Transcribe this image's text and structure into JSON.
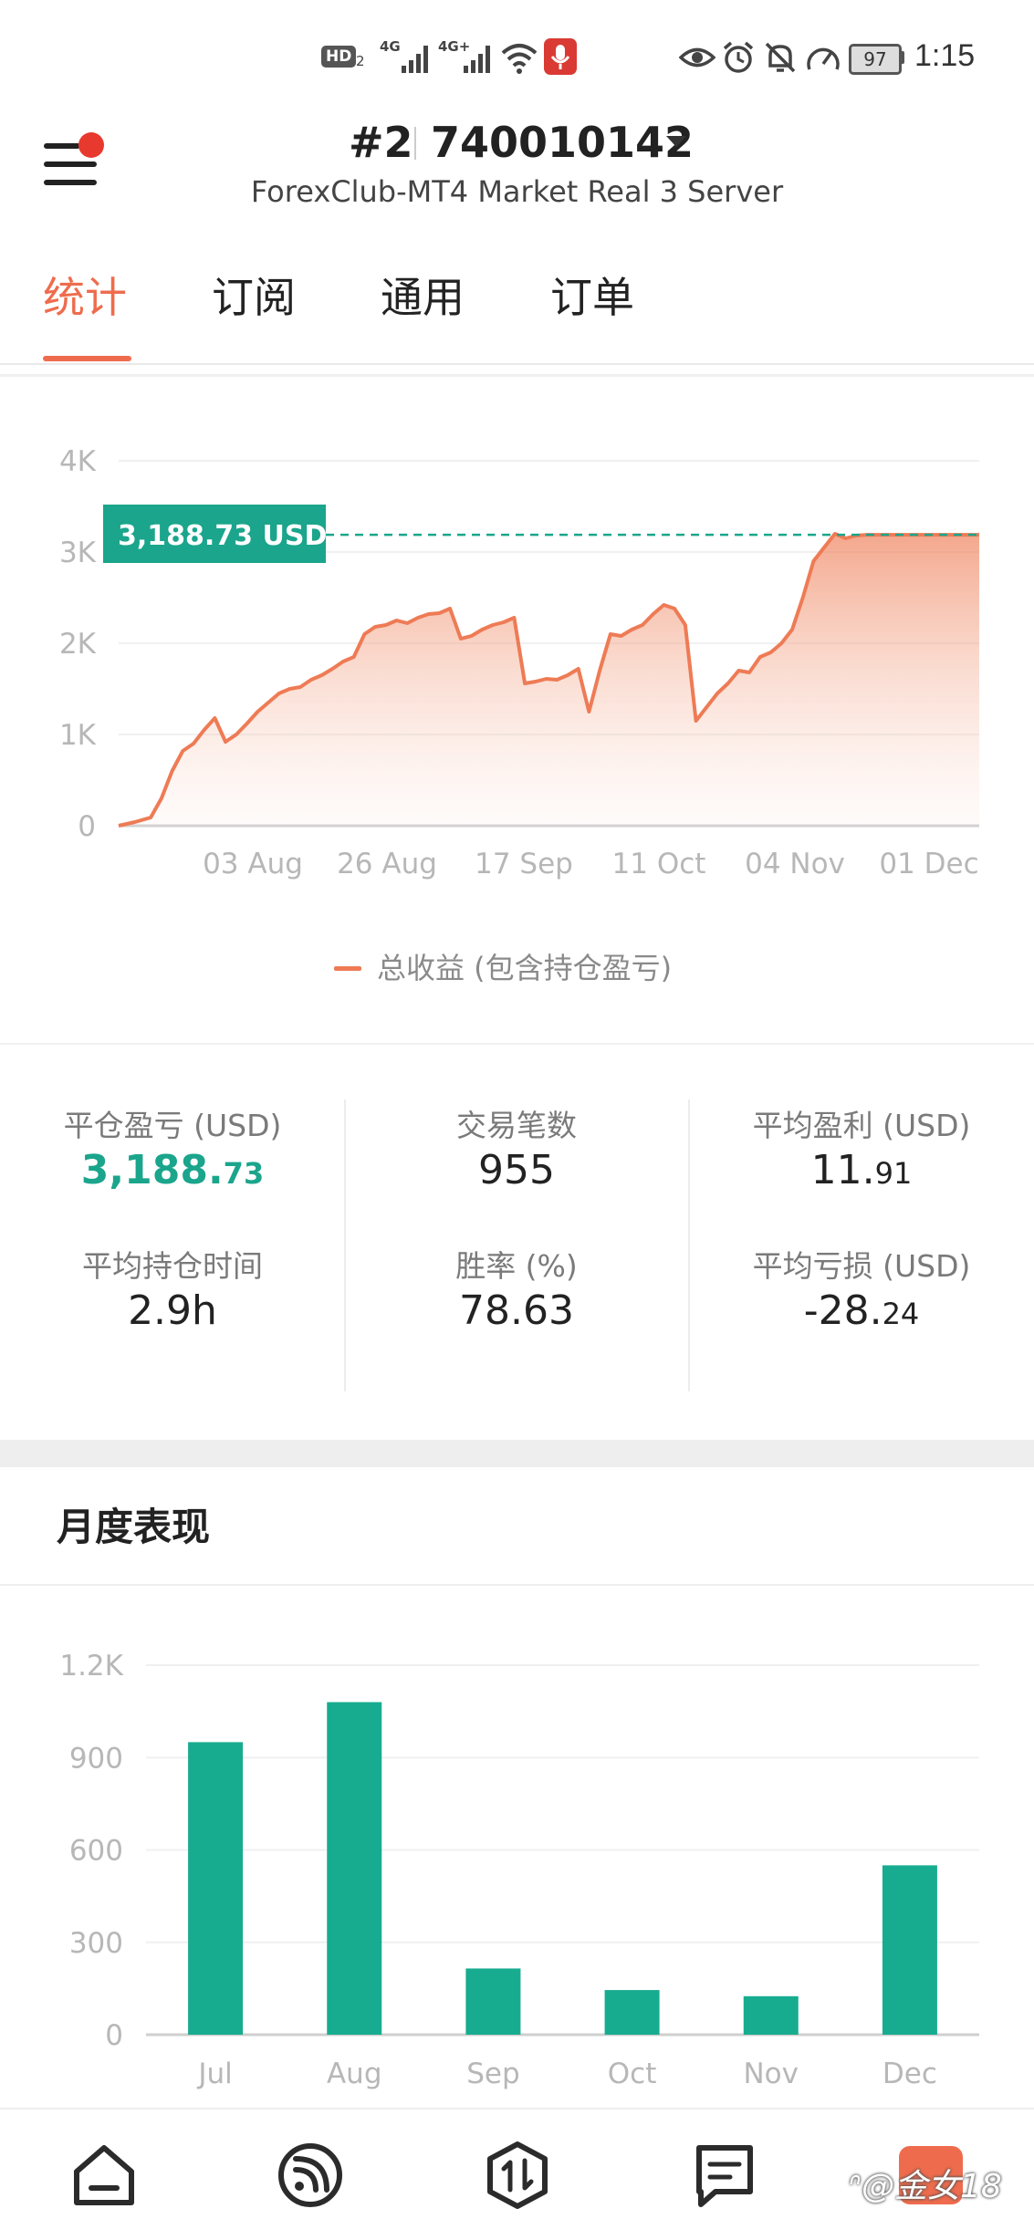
{
  "status_bar": {
    "time": "1:15",
    "battery": "97",
    "network_1": "4G",
    "network_2": "4G+",
    "hd_label": "HD",
    "sim_index": "2"
  },
  "header": {
    "account_prefix": "#2",
    "account_id": "740010142",
    "server": "ForexClub-MT4 Market Real 3 Server"
  },
  "tabs": [
    {
      "label": "统计",
      "active": true
    },
    {
      "label": "订阅",
      "active": false
    },
    {
      "label": "通用",
      "active": false
    },
    {
      "label": "订单",
      "active": false
    }
  ],
  "equity_chart": {
    "current_value_label": "3,188.73 USD",
    "legend": "总收益 (包含持仓盈亏)",
    "y_ticks": [
      "4K",
      "3K",
      "2K",
      "1K",
      "0"
    ],
    "x_ticks": [
      "03 Aug",
      "26 Aug",
      "17 Sep",
      "11 Oct",
      "04 Nov",
      "01 Dec"
    ],
    "line_color": "#ee7b55",
    "tag_color": "#1aa58c"
  },
  "stats": {
    "closed_pl_label": "平仓盈亏 (USD)",
    "closed_pl_int": "3,188.",
    "closed_pl_dec": "73",
    "trades_label": "交易笔数",
    "trades_value": "955",
    "avg_profit_label": "平均盈利 (USD)",
    "avg_profit_int": "11.",
    "avg_profit_dec": "91",
    "avg_hold_label": "平均持仓时间",
    "avg_hold_value": "2.9h",
    "win_rate_label": "胜率 (%)",
    "win_rate_value": "78.63",
    "avg_loss_label": "平均亏损 (USD)",
    "avg_loss_int": "-28.",
    "avg_loss_dec": "24"
  },
  "monthly": {
    "title": "月度表现"
  },
  "chart_data": [
    {
      "type": "area",
      "title": "",
      "legend": [
        "总收益 (包含持仓盈亏)"
      ],
      "x_ticks": [
        "03 Aug",
        "26 Aug",
        "17 Sep",
        "11 Oct",
        "04 Nov",
        "01 Dec"
      ],
      "ylim": [
        0,
        4000
      ],
      "y_ticks": [
        0,
        1000,
        2000,
        3000,
        4000
      ],
      "last_value": 3188.73,
      "x": [
        0,
        3,
        6,
        8,
        10,
        12,
        14,
        16,
        18,
        20,
        22,
        24,
        26,
        28,
        30,
        32,
        34,
        36,
        38,
        40,
        42,
        44,
        46,
        48,
        50,
        52,
        54,
        56,
        58,
        60,
        62,
        64,
        66,
        68,
        70,
        72,
        74,
        76,
        78,
        80,
        82,
        84,
        86,
        88,
        90,
        92,
        94,
        96,
        98,
        100,
        102,
        104,
        106,
        108,
        110,
        112,
        114,
        116,
        118,
        120,
        122,
        124,
        126,
        128,
        130,
        132,
        134,
        136,
        138,
        140,
        142,
        144,
        146,
        148,
        150,
        152,
        154,
        156,
        158,
        160,
        161
      ],
      "values": [
        0,
        40,
        90,
        300,
        600,
        820,
        900,
        1050,
        1180,
        920,
        1000,
        1120,
        1250,
        1350,
        1450,
        1500,
        1520,
        1600,
        1650,
        1720,
        1800,
        1850,
        2100,
        2180,
        2200,
        2250,
        2220,
        2280,
        2320,
        2330,
        2380,
        2050,
        2080,
        2150,
        2200,
        2230,
        2280,
        1560,
        1580,
        1610,
        1600,
        1650,
        1720,
        1250,
        1700,
        2100,
        2080,
        2150,
        2200,
        2320,
        2420,
        2380,
        2200,
        1150,
        1300,
        1450,
        1560,
        1700,
        1680,
        1850,
        1900,
        2000,
        2150,
        2500,
        2900,
        3050,
        3200,
        3150,
        3180,
        3188.73,
        3188.73,
        3188.73,
        3188.73,
        3188.73,
        3188.73,
        3188.73,
        3188.73,
        3188.73,
        3188.73,
        3188.73,
        3188.73
      ]
    },
    {
      "type": "bar",
      "title": "月度表现",
      "categories": [
        "Jul",
        "Aug",
        "Sep",
        "Oct",
        "Nov",
        "Dec"
      ],
      "values": [
        950,
        1080,
        215,
        145,
        125,
        550
      ],
      "ylim": [
        0,
        1200
      ],
      "y_ticks": [
        0,
        300,
        600,
        900,
        1200
      ],
      "y_tick_labels": [
        "0",
        "300",
        "600",
        "900",
        "1.2K"
      ],
      "color": "#17ac8f"
    }
  ]
}
